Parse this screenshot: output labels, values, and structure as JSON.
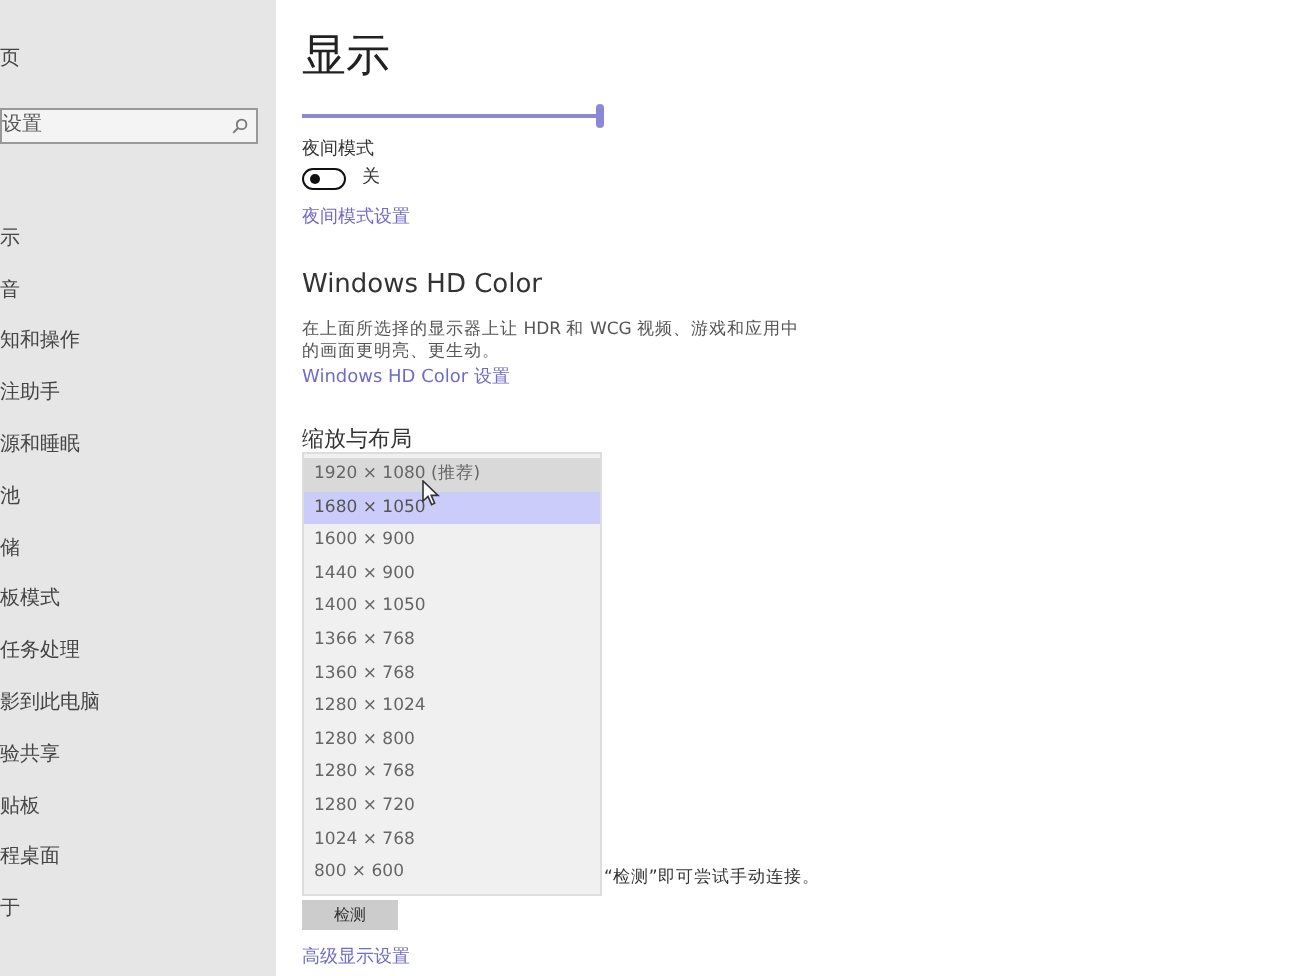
{
  "sidebar": {
    "items": [
      {
        "text": "页"
      },
      {
        "kind": "search",
        "placeholder": "设置"
      },
      {
        "text": "示"
      },
      {
        "text": "音"
      },
      {
        "text": "知和操作"
      },
      {
        "text": "注助手"
      },
      {
        "text": "源和睡眠"
      },
      {
        "text": "池"
      },
      {
        "text": "储"
      },
      {
        "text": "板模式"
      },
      {
        "text": "任务处理"
      },
      {
        "text": "影到此电脑"
      },
      {
        "text": "验共享"
      },
      {
        "text": "贴板"
      },
      {
        "text": "程桌面"
      },
      {
        "text": "于"
      }
    ]
  },
  "main": {
    "title": "显示",
    "brightness": {
      "level": 1.0
    },
    "night_light": {
      "label": "夜间模式",
      "on": false,
      "state_text": "关",
      "link": "夜间模式设置"
    },
    "hd_color": {
      "heading": "Windows HD Color",
      "description": "在上面所选择的显示器上让 HDR 和 WCG 视频、游戏和应用中的画面更明亮、更生动。",
      "link": "Windows HD Color 设置"
    },
    "scale_heading": "缩放与布局",
    "connect_hint": "“检测”即可尝试手动连接。",
    "detect_button": "检测",
    "advanced_link": "高级显示设置"
  },
  "resolution_dropdown": {
    "options": [
      {
        "text": "1920 × 1080 (推荐)",
        "selected": false,
        "hovered": true
      },
      {
        "text": "1680 × 1050",
        "selected": true,
        "hovered": false
      },
      {
        "text": "1600 × 900",
        "selected": false,
        "hovered": false
      },
      {
        "text": "1440 × 900",
        "selected": false,
        "hovered": false
      },
      {
        "text": "1400 × 1050",
        "selected": false,
        "hovered": false
      },
      {
        "text": "1366 × 768",
        "selected": false,
        "hovered": false
      },
      {
        "text": "1360 × 768",
        "selected": false,
        "hovered": false
      },
      {
        "text": "1280 × 1024",
        "selected": false,
        "hovered": false
      },
      {
        "text": "1280 × 800",
        "selected": false,
        "hovered": false
      },
      {
        "text": "1280 × 768",
        "selected": false,
        "hovered": false
      },
      {
        "text": "1280 × 720",
        "selected": false,
        "hovered": false
      },
      {
        "text": "1024 × 768",
        "selected": false,
        "hovered": false
      },
      {
        "text": "800 × 600",
        "selected": false,
        "hovered": false
      }
    ]
  }
}
